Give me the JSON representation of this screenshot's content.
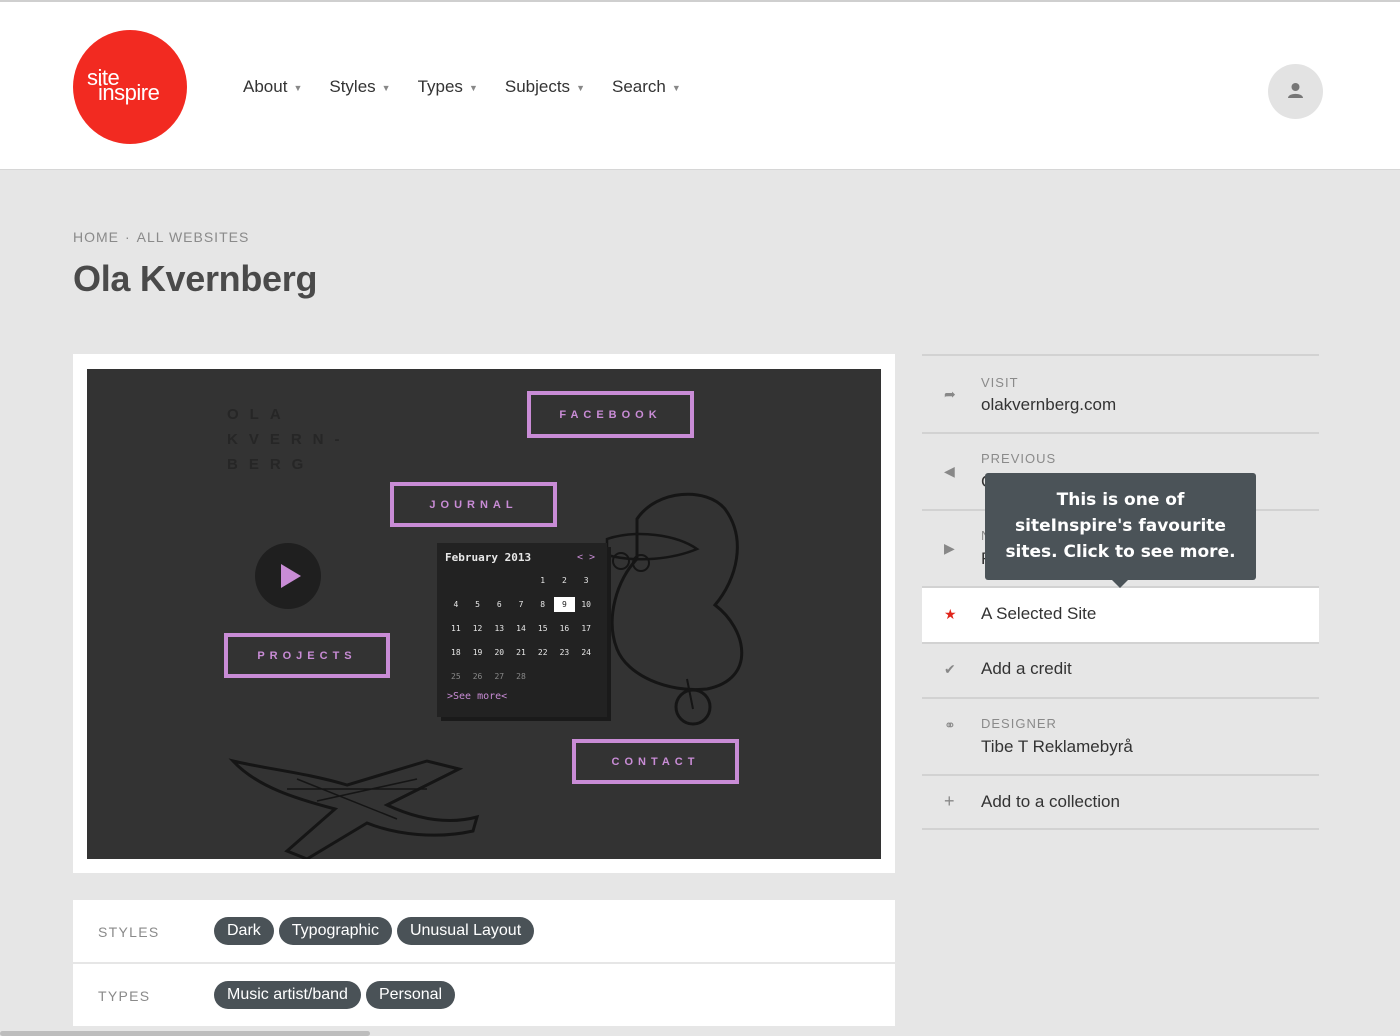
{
  "logo": {
    "line1": "site",
    "line2": "inspire"
  },
  "nav": {
    "items": [
      {
        "label": "About"
      },
      {
        "label": "Styles"
      },
      {
        "label": "Types"
      },
      {
        "label": "Subjects"
      },
      {
        "label": "Search"
      }
    ]
  },
  "breadcrumb": {
    "home": "HOME",
    "separator": "·",
    "all": "ALL WEBSITES"
  },
  "page_title": "Ola Kvernberg",
  "screenshot": {
    "name_lines": [
      "OLA",
      "KVERN-",
      "BERG"
    ],
    "facebook": "FACEBOOK",
    "journal": "JOURNAL",
    "projects": "PROJECTS",
    "contact": "CONTACT",
    "calendar": {
      "month": "February 2013",
      "nav": "< >",
      "rows": [
        [
          "",
          "",
          "",
          "",
          "1",
          "2",
          "3"
        ],
        [
          "4",
          "5",
          "6",
          "7",
          "8",
          "9",
          "10"
        ],
        [
          "11",
          "12",
          "13",
          "14",
          "15",
          "16",
          "17"
        ],
        [
          "18",
          "19",
          "20",
          "21",
          "22",
          "23",
          "24"
        ],
        [
          "25",
          "26",
          "27",
          "28",
          "",
          "",
          ""
        ]
      ],
      "selected_day": "9",
      "see_more": ">See more<"
    },
    "accent_color": "#c98cd6"
  },
  "sidebar": {
    "visit_label": "VISIT",
    "visit_value": "olakvernberg.com",
    "previous_label": "PREVIOUS",
    "previous_value": "C",
    "next_label": "N",
    "next_value": "R",
    "selected": "A Selected Site",
    "credit": "Add a credit",
    "designer_label": "DESIGNER",
    "designer_value": "Tibe T Reklamebyrå",
    "collection": "Add to a collection"
  },
  "tooltip": "This is one of siteInspire's favourite sites. Click to see more.",
  "styles": {
    "label": "STYLES",
    "tags": [
      "Dark",
      "Typographic",
      "Unusual Layout"
    ]
  },
  "types": {
    "label": "TYPES",
    "tags": [
      "Music artist/band",
      "Personal"
    ]
  },
  "colors": {
    "brand": "#f22a21",
    "tag_bg": "#4a5257",
    "tooltip_bg": "#4b5358",
    "star": "#e0251b"
  }
}
